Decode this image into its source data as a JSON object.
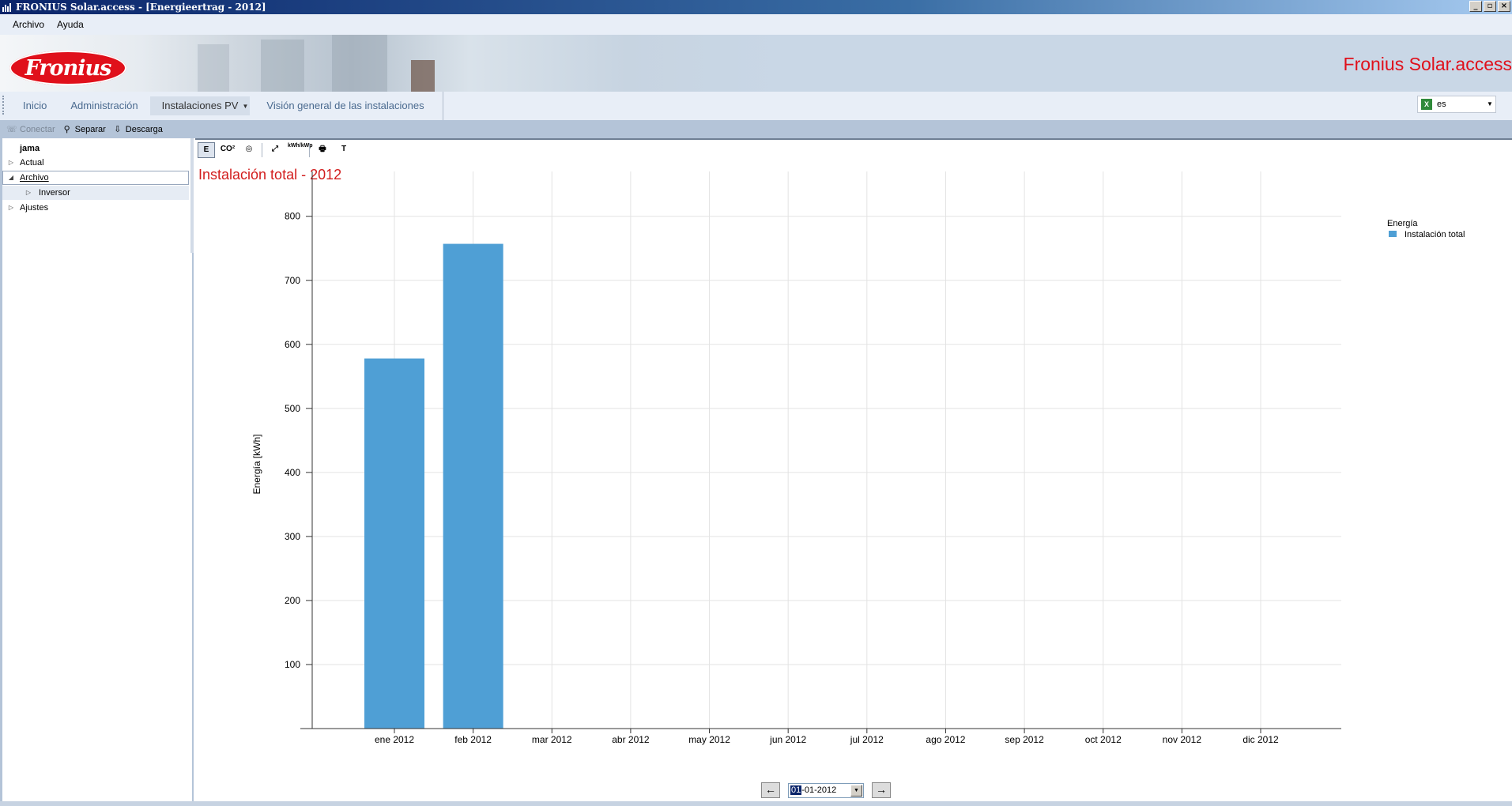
{
  "window": {
    "title": "FRONIUS Solar.access - [Energieertrag - 2012]",
    "controls": [
      "_",
      "▫",
      "×"
    ]
  },
  "menu": [
    "Archivo",
    "Ayuda"
  ],
  "banner": {
    "logo_text": "Fronius",
    "brand": "Fronius Solar.access"
  },
  "nav": {
    "tabs": [
      "Inicio",
      "Administración",
      "Instalaciones PV",
      "Visión general de las instalaciones"
    ],
    "active_tab": "Instalaciones PV",
    "language": "es"
  },
  "toolbar": {
    "connect": "Conectar",
    "disconnect": "Separar",
    "download": "Descarga"
  },
  "tree": {
    "root": "jama",
    "items": [
      "Actual",
      "Archivo",
      "Inversor",
      "Ajustes"
    ]
  },
  "chart_toolbar": [
    "E",
    "CO²",
    "◎",
    "⤢",
    "kWh/kWp",
    "🖶",
    "T"
  ],
  "chart_title": "Instalación total - 2012",
  "chart_data": {
    "type": "bar",
    "categories": [
      "ene 2012",
      "feb 2012",
      "mar 2012",
      "abr 2012",
      "may 2012",
      "jun 2012",
      "jul 2012",
      "ago 2012",
      "sep 2012",
      "oct 2012",
      "nov 2012",
      "dic 2012"
    ],
    "series": [
      {
        "name": "Instalación total",
        "values": [
          578,
          757,
          0,
          0,
          0,
          0,
          0,
          0,
          0,
          0,
          0,
          0
        ],
        "color": "#4f9fd5"
      }
    ],
    "ylabel": "Energía [kWh]",
    "ylim": [
      0,
      870
    ],
    "yticks": [
      100,
      200,
      300,
      400,
      500,
      600,
      700,
      800
    ],
    "legend_title": "Energía",
    "grid": true,
    "legend_position": "top-right"
  },
  "date_nav": {
    "prev": "←",
    "next": "→",
    "date_day": "01",
    "date_rest": "-01-2012"
  }
}
